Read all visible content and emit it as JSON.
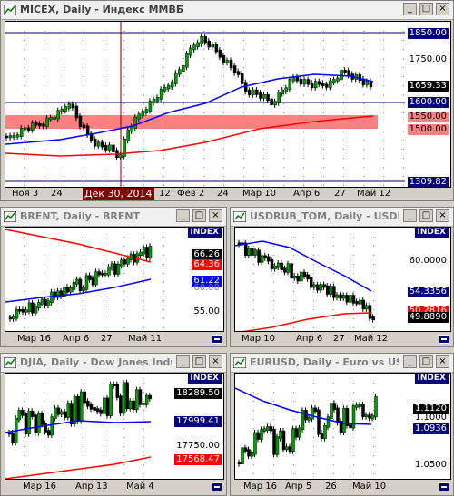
{
  "windows": [
    {
      "title": "MICEX, Daily - Индекс ММВБ",
      "price_labels": {
        "top": "1850.00",
        "mid1": "1750.00",
        "current": "1659.33",
        "blue_line": "1600.00",
        "red1": "1550.00",
        "red2": "1500.00",
        "bottom": "1309.82"
      },
      "time_labels": [
        "Ноя 3",
        "24",
        "Дек 30, 2014",
        "12",
        "Фев 2",
        "24",
        "Мар 10",
        "Апр 6",
        "27",
        "Май 12"
      ],
      "cursor_label": "Дек 30, 2014"
    },
    {
      "title": "BRENT, Daily - BRENT",
      "index_label": "INDEX",
      "price_labels": [
        "66.26",
        "64.36",
        "61.22",
        "60.00",
        "55.00"
      ],
      "time_labels": [
        "Мар 16",
        "Апр 6",
        "27",
        "Май 11"
      ]
    },
    {
      "title": "USDRUB_TOM, Daily - USDR...",
      "index_label": "INDEX",
      "price_labels": [
        "60.0000",
        "54.3356",
        "50.2816",
        "49.8890"
      ],
      "time_labels": [
        "Мар 10",
        "Апр 6",
        "27",
        "Май 12"
      ]
    },
    {
      "title": "DJIA, Daily - Dow Jones Indu...",
      "index_label": "INDEX",
      "price_labels": [
        "18289.50",
        "17999.41",
        "17750.00",
        "17568.47"
      ],
      "time_labels": [
        "Мар 16",
        "Апр 13",
        "Май 4"
      ]
    },
    {
      "title": "EURUSD, Daily - Euro vs US ...",
      "index_label": "INDEX",
      "price_labels": [
        "1.1120",
        "1.1000",
        "1.0936",
        "1.0500"
      ],
      "time_labels": [
        "Мар 16",
        "Апр 5",
        "26",
        "Май 10"
      ]
    }
  ],
  "window_buttons": {
    "minimize": "_",
    "maximize": "□",
    "close": "×"
  },
  "colors": {
    "candle": "#008000",
    "ma_blue": "#0000ff",
    "ma_red": "#ff0000",
    "zone": "#ff8080"
  }
}
